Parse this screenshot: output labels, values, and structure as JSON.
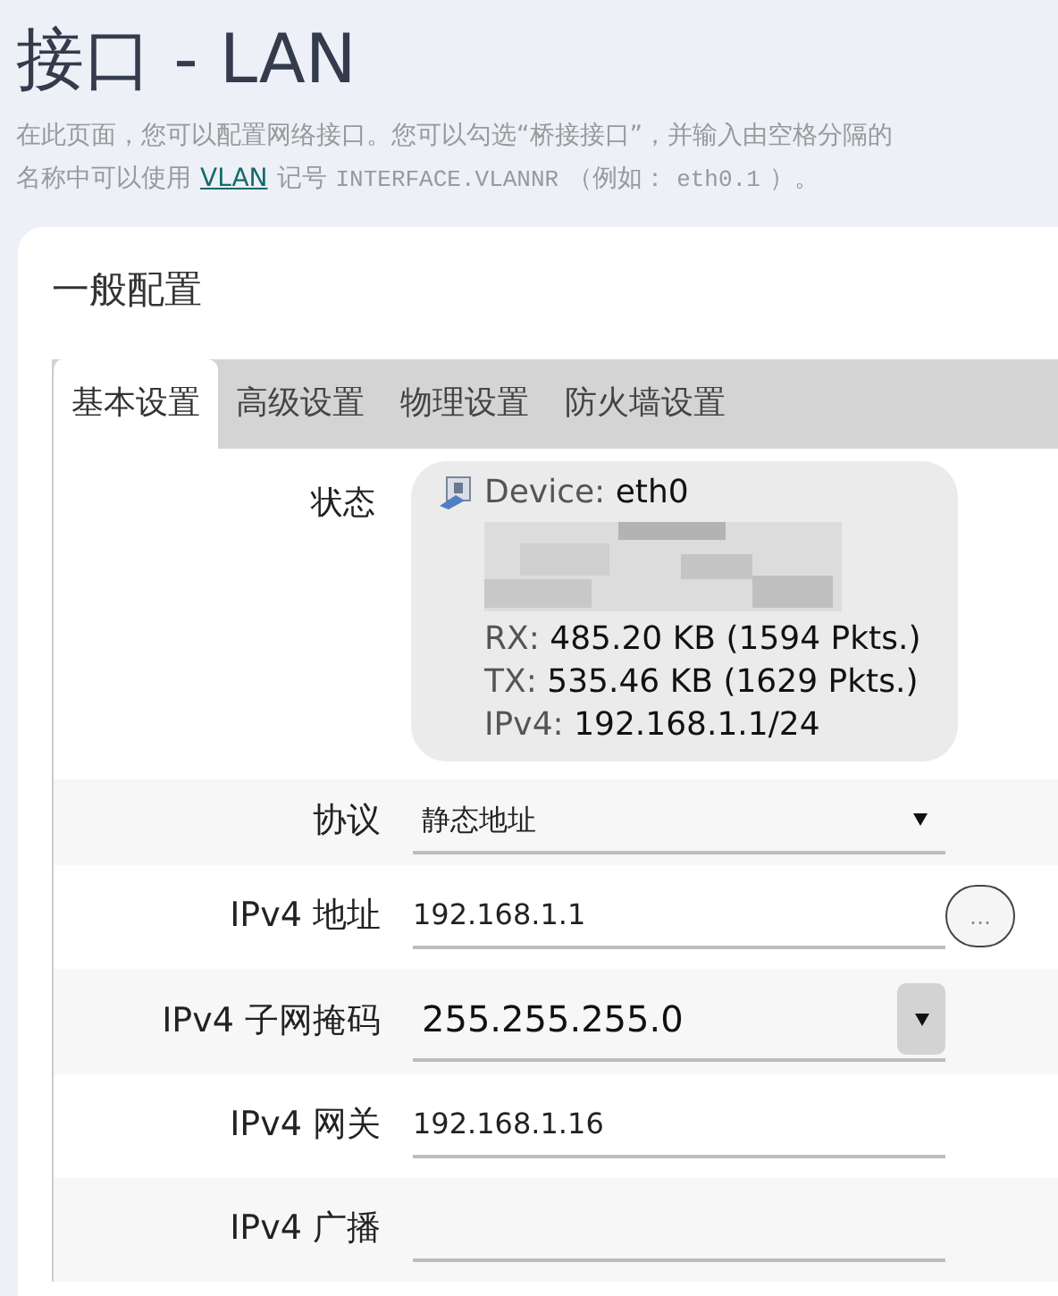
{
  "page": {
    "title": "接口 - LAN",
    "description_line1": "在此页面，您可以配置网络接口。您可以勾选“桥接接口”，并输入由空格分隔的",
    "description_line2": [
      {
        "kind": "text",
        "text": "名称中可以使用"
      },
      {
        "kind": "link",
        "text": "VLAN"
      },
      {
        "kind": "text",
        "text": "记号"
      },
      {
        "kind": "code",
        "text": "INTERFACE.VLANNR"
      },
      {
        "kind": "text",
        "text": "（例如："
      },
      {
        "kind": "code",
        "text": "eth0.1"
      },
      {
        "kind": "text",
        "text": "）。"
      }
    ]
  },
  "section": {
    "title": "一般配置",
    "tabs": [
      {
        "label": "基本设置",
        "selected": true
      },
      {
        "label": "高级设置",
        "selected": false
      },
      {
        "label": "物理设置",
        "selected": false
      },
      {
        "label": "防火墙设置",
        "selected": false
      }
    ],
    "status": {
      "label": "状态",
      "device_label": "Device:",
      "device_value": "eth0",
      "lines": [
        {
          "label": "RX:",
          "value": "485.20 KB (1594 Pkts.)"
        },
        {
          "label": "TX:",
          "value": "535.46 KB (1629 Pkts.)"
        },
        {
          "label": "IPv4:",
          "value": "192.168.1.1/24"
        }
      ]
    },
    "fields": [
      {
        "kind": "select",
        "label": "协议",
        "value": "静态地址"
      },
      {
        "kind": "input",
        "label": "IPv4 地址",
        "value": "192.168.1.1",
        "more_button": "…"
      },
      {
        "kind": "combo",
        "label": "IPv4 子网掩码",
        "value": "255.255.255.0"
      },
      {
        "kind": "input",
        "label": "IPv4 网关",
        "value": "192.168.1.16"
      },
      {
        "kind": "input",
        "label": "IPv4 广播"
      }
    ]
  }
}
